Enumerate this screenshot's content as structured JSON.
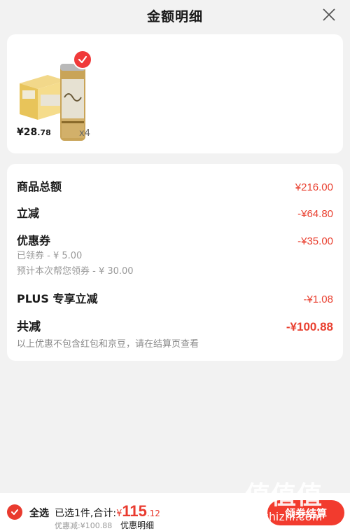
{
  "header": {
    "title": "金额明细"
  },
  "product": {
    "price_main": "¥28",
    "price_cents": ".78",
    "quantity": "x4"
  },
  "details": {
    "goods_total_label": "商品总额",
    "goods_total_value": "¥216.00",
    "instant_discount_label": "立减",
    "instant_discount_value": "-¥64.80",
    "coupon_label": "优惠券",
    "coupon_value": "-¥35.00",
    "coupon_claimed": "已领券 - ¥ 5.00",
    "coupon_estimated": "预计本次帮您领券 - ¥ 30.00",
    "plus_label": "PLUS 专享立减",
    "plus_value": "-¥1.08",
    "total_saved_label": "共减",
    "total_saved_value": "-¥100.88",
    "note": "以上优惠不包含红包和京豆，请在结算页查看"
  },
  "footer": {
    "select_all": "全选",
    "summary_prefix": "已选1件,合计:",
    "yen": "¥",
    "amount": "115",
    "cents": ".12",
    "saved": "优惠减:¥100.88",
    "detail_link": "优惠明细",
    "checkout": "领券结算"
  },
  "watermark": {
    "logo": "值值值",
    "site": "zhizhizhi.com"
  },
  "colors": {
    "accent": "#e93b2f",
    "background": "#f2f2f2"
  },
  "icons": [
    "close-icon",
    "check-icon",
    "product-image"
  ]
}
